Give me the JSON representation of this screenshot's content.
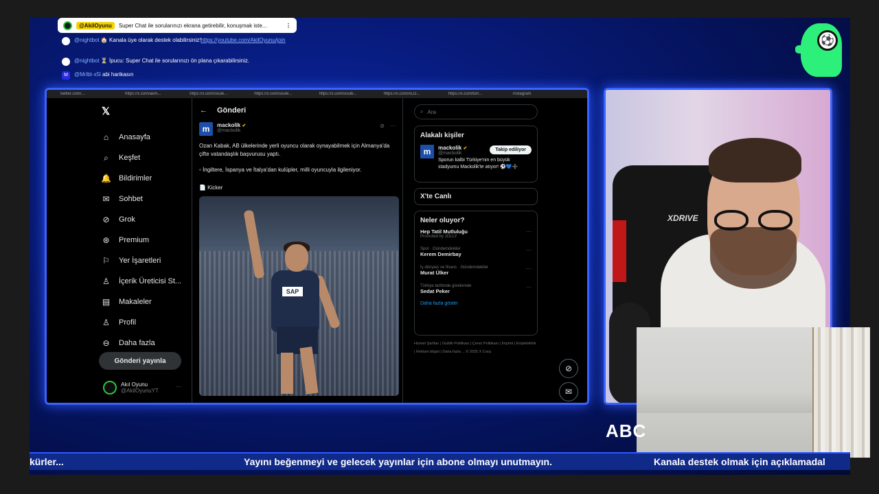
{
  "chat": {
    "pinned": {
      "name": "@AkilOyunu",
      "message": "Super Chat ile sorularınızı ekrana getirebilir, konuşmak iste..."
    },
    "lines": [
      {
        "user": "@nightbot",
        "emoji": "🏠",
        "text": "Kanala üye olarak destek olabilirsiniz!",
        "link": "https://youtube.com/AkilOyunu/join"
      },
      {
        "user": "@nightbot",
        "emoji": "⏳",
        "text": "İpucu: Super Chat ile sorularınızı ön plana çıkarabilirsiniz."
      },
      {
        "user": "@Mrlbt-x5l",
        "text": "abi harikasın"
      }
    ]
  },
  "browser": {
    "tabs": [
      "twitter.com/...",
      "https://x.com/aem...",
      "https://x.com/soule...",
      "https://x.com/soule...",
      "https://x.com/soulb...",
      "https://x.com/ALO...",
      "https://x.com/torr...",
      "Instagram"
    ]
  },
  "x": {
    "nav": [
      {
        "icon": "home-icon",
        "glyph": "⌂",
        "label": "Anasayfa"
      },
      {
        "icon": "search-icon",
        "glyph": "⌕",
        "label": "Keşfet"
      },
      {
        "icon": "bell-icon",
        "glyph": "🔔",
        "label": "Bildirimler"
      },
      {
        "icon": "mail-icon",
        "glyph": "✉",
        "label": "Sohbet"
      },
      {
        "icon": "grok-icon",
        "glyph": "⊘",
        "label": "Grok"
      },
      {
        "icon": "premium-icon",
        "glyph": "⊛",
        "label": "Premium"
      },
      {
        "icon": "bookmark-icon",
        "glyph": "⚐",
        "label": "Yer İşaretleri"
      },
      {
        "icon": "creator-icon",
        "glyph": "♙",
        "label": "İçerik Üreticisi St..."
      },
      {
        "icon": "articles-icon",
        "glyph": "▤",
        "label": "Makaleler"
      },
      {
        "icon": "profile-icon",
        "glyph": "♙",
        "label": "Profil"
      },
      {
        "icon": "more-icon",
        "glyph": "⊖",
        "label": "Daha fazla"
      }
    ],
    "post_button": "Gönderi yayınla",
    "account": {
      "name": "Akıl Oyunu",
      "handle": "@AkilOyunuYT"
    },
    "page_title": "Gönderi",
    "post": {
      "author": "mackolik",
      "handle": "@mackolik",
      "text": "Ozan Kabak, AB ülkelerinde yerli oyuncu olarak oynayabilmek için Almanya'da çifte vatandaşlık başvurusu yaptı.",
      "bullet": "İngiltere, İspanya ve İtalya'dan kulüpler, milli oyuncuyla ilgileniyor.",
      "source": "📄 Kicker",
      "jersey_sponsor": "SAP"
    },
    "search_placeholder": "Ara",
    "related": {
      "title": "Alakalı kişiler",
      "name": "mackolik",
      "handle": "@mackolik",
      "follow": "Takip ediliyor",
      "bio": "Sporun kalbi Türkiye'nin en büyük stadyumu Mackolik'te atıyor! ⚽💙➕"
    },
    "live": {
      "title": "X'te Canlı"
    },
    "trends": {
      "title": "Neler oluyor?",
      "items": [
        {
          "meta": "",
          "title": "Hep Tatil Mutluluğu",
          "sub": "Promoted by JOLLY"
        },
        {
          "meta": "Spor · Gündemdekiler",
          "title": "Kerem Demirbay"
        },
        {
          "meta": "İş dünyası ve finans · Gündemdekiler",
          "title": "Murat Ülker"
        },
        {
          "meta": "Türkiye tarihinde gündemde",
          "title": "Sedat Peker"
        }
      ],
      "show_more": "Daha fazla göster"
    },
    "footer": "Hizmet Şartları | Gizlilik Politikası | Çerez Politikası | İmprint | Erişilebilirlik | Reklam bilgisi | Daha fazla ... © 2025 X Corp."
  },
  "chair_brand": "XDRIVE",
  "overlay_text": "ABC",
  "ticker": {
    "left": "kürler...",
    "center": "Yayını beğenmeyi ve gelecek yayınlar için abone olmayı unutmayın.",
    "right": "Kanala destek olmak için açıklamadal"
  },
  "colors": {
    "accent": "#3a62ff",
    "brand_green": "#2df07a",
    "x_blue": "#1d9bf0"
  }
}
